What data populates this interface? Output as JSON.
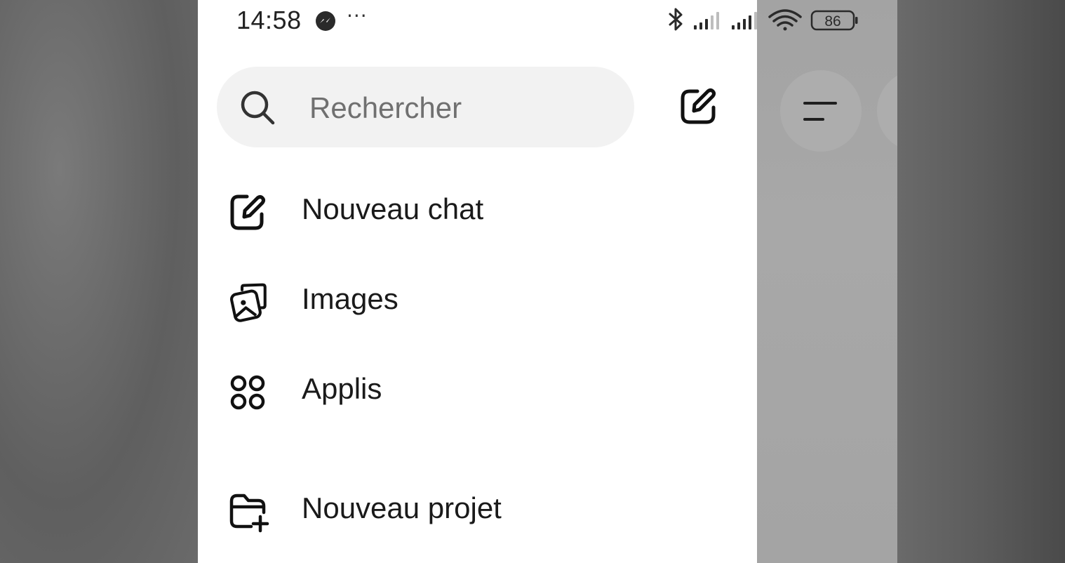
{
  "status_bar": {
    "time": "14:58",
    "more": "···",
    "battery": "86"
  },
  "search": {
    "placeholder": "Rechercher"
  },
  "menu": {
    "items": [
      {
        "label": "Nouveau chat",
        "icon": "edit-icon"
      },
      {
        "label": "Images",
        "icon": "images-icon"
      },
      {
        "label": "Applis",
        "icon": "apps-icon"
      },
      {
        "label": "Nouveau projet",
        "icon": "folder-add-icon"
      }
    ]
  }
}
